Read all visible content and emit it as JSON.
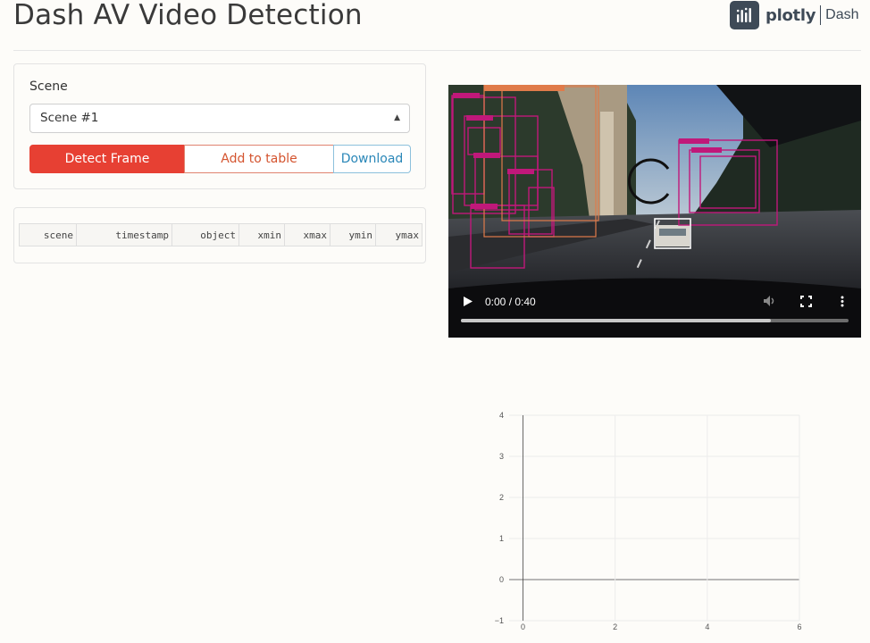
{
  "header": {
    "title": "Dash AV Video Detection",
    "brand_word": "plotly",
    "brand_product": "Dash"
  },
  "controls": {
    "scene_label": "Scene",
    "scene_selected": "Scene #1",
    "detect_button": "Detect Frame",
    "add_button": "Add to table",
    "download_button": "Download"
  },
  "table": {
    "columns": [
      "scene",
      "timestamp",
      "object",
      "xmin",
      "xmax",
      "ymin",
      "ymax"
    ]
  },
  "video": {
    "time_display": "0:00 / 0:40",
    "progress": 0.8,
    "colors": {
      "box": "#c0187a",
      "box_label": "#c0187a",
      "car_box": "#ffffff",
      "tree_box": "#e07b4a"
    }
  },
  "chart_data": {
    "type": "scatter",
    "x_ticks": [
      "0",
      "2",
      "4",
      "6"
    ],
    "y_ticks": [
      "4",
      "3",
      "2",
      "1",
      "0",
      "−1"
    ],
    "xlim": [
      -0.3,
      6
    ],
    "ylim": [
      -1,
      4
    ],
    "series": []
  }
}
